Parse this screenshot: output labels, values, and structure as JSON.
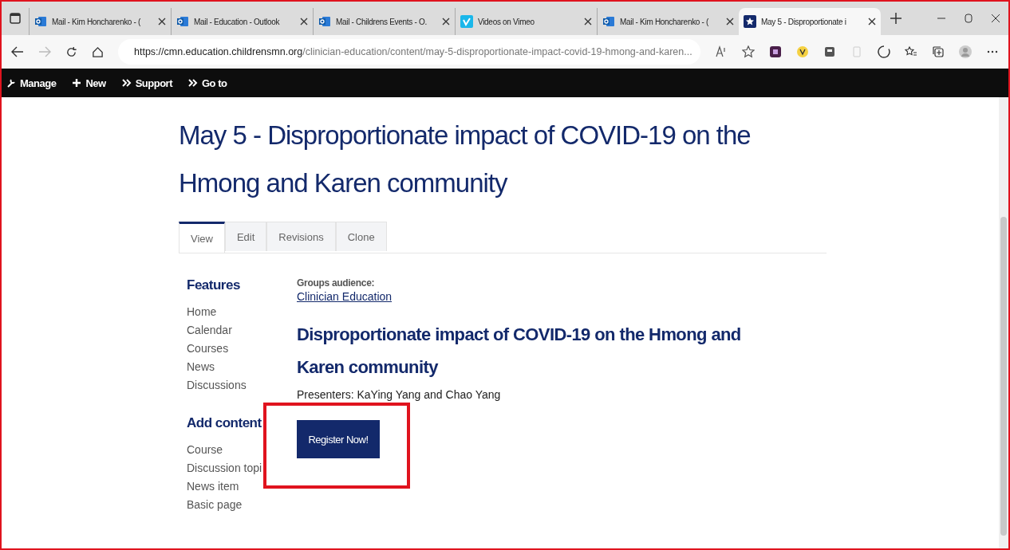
{
  "browser": {
    "tabs": [
      {
        "title": "Mail - Kim Honcharenko - (",
        "selected": false
      },
      {
        "title": "Mail - Education - Outlook",
        "selected": false
      },
      {
        "title": "Mail - Childrens Events - O.",
        "selected": false
      },
      {
        "title": "Videos on Vimeo",
        "selected": false
      },
      {
        "title": "Mail - Kim Honcharenko - (",
        "selected": false
      },
      {
        "title": "May 5 - Disproportionate i",
        "selected": true
      }
    ],
    "url_host": "https://cmn.education.childrensmn.org",
    "url_path": "/clinician-education/content/may-5-disproportionate-impact-covid-19-hmong-and-karen..."
  },
  "toolbar": [
    {
      "label": "Manage"
    },
    {
      "label": "New"
    },
    {
      "label": "Support"
    },
    {
      "label": "Go to"
    }
  ],
  "page": {
    "title": "May 5 - Disproportionate impact of COVID-19 on the Hmong and Karen community",
    "tabs": [
      {
        "label": "View",
        "selected": true
      },
      {
        "label": "Edit",
        "selected": false
      },
      {
        "label": "Revisions",
        "selected": false
      },
      {
        "label": "Clone",
        "selected": false
      }
    ],
    "sidebar": [
      {
        "heading": "Features",
        "items": [
          "Home",
          "Calendar",
          "Courses",
          "News",
          "Discussions"
        ]
      },
      {
        "heading": "Add content",
        "items": [
          "Course",
          "Discussion topi",
          "News item",
          "Basic page"
        ]
      }
    ],
    "groups_label": "Groups audience:",
    "groups_link": "Clinician Education",
    "heading": "Disproportionate impact of COVID-19 on the Hmong and Karen community",
    "presenters": "Presenters: KaYing Yang and Chao Yang",
    "button": "Register Now!"
  }
}
